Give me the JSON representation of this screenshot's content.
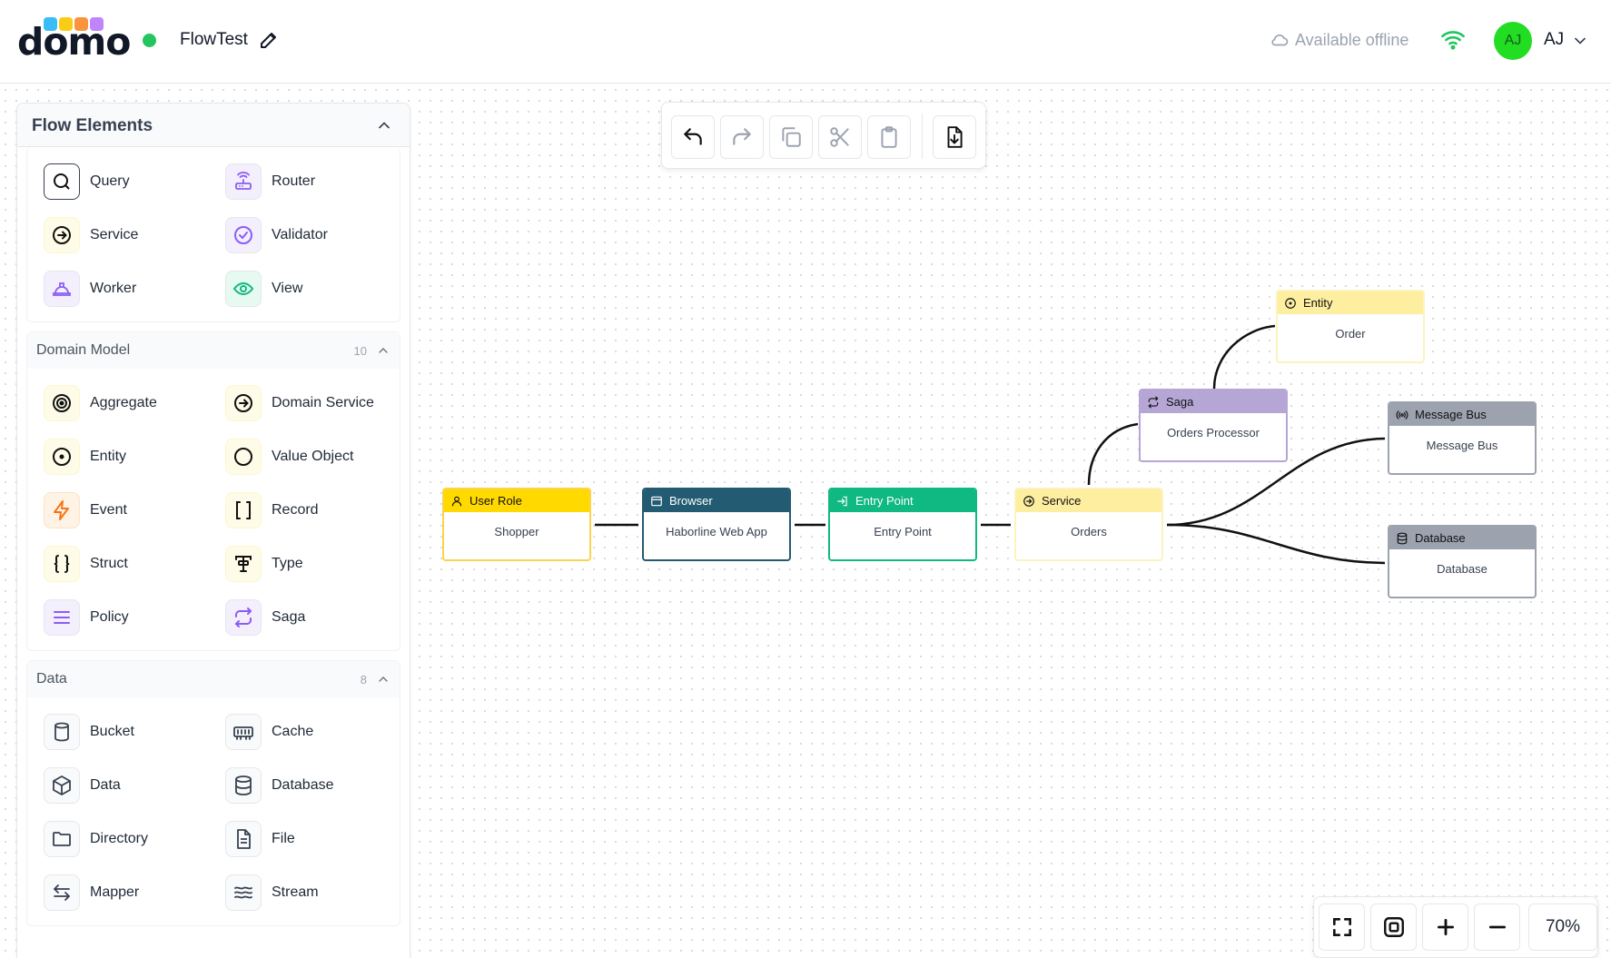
{
  "header": {
    "logo_text": "domo",
    "project_name": "FlowTest",
    "offline_label": "Available offline",
    "avatar_initials": "AJ",
    "user_initials": "AJ",
    "colors": {
      "status": "#22c55e",
      "avatar": "#22dd22",
      "logo_dots": [
        "#38bdf8",
        "#facc15",
        "#fb923c",
        "#c084fc"
      ]
    }
  },
  "sidebar": {
    "title": "Flow Elements",
    "groups": [
      {
        "title": "",
        "count": "",
        "items": [
          {
            "label": "Query",
            "icon": "search-icon"
          },
          {
            "label": "Router",
            "icon": "router-icon"
          },
          {
            "label": "Service",
            "icon": "arrow-circle-icon"
          },
          {
            "label": "Validator",
            "icon": "check-circle-icon"
          },
          {
            "label": "Worker",
            "icon": "hardhat-icon"
          },
          {
            "label": "View",
            "icon": "eye-icon"
          }
        ]
      },
      {
        "title": "Domain Model",
        "count": "10",
        "items": [
          {
            "label": "Aggregate",
            "icon": "target-icon"
          },
          {
            "label": "Domain Service",
            "icon": "arrow-circle-icon"
          },
          {
            "label": "Entity",
            "icon": "dot-circle-icon"
          },
          {
            "label": "Value Object",
            "icon": "circle-icon"
          },
          {
            "label": "Event",
            "icon": "lightning-icon"
          },
          {
            "label": "Record",
            "icon": "brackets-icon"
          },
          {
            "label": "Struct",
            "icon": "braces-icon"
          },
          {
            "label": "Type",
            "icon": "type-icon"
          },
          {
            "label": "Policy",
            "icon": "lines-icon"
          },
          {
            "label": "Saga",
            "icon": "repeat-icon"
          }
        ]
      },
      {
        "title": "Data",
        "count": "8",
        "items": [
          {
            "label": "Bucket",
            "icon": "cylinder-icon"
          },
          {
            "label": "Cache",
            "icon": "memory-icon"
          },
          {
            "label": "Data",
            "icon": "cube-icon"
          },
          {
            "label": "Database",
            "icon": "database-icon"
          },
          {
            "label": "Directory",
            "icon": "folder-icon"
          },
          {
            "label": "File",
            "icon": "file-icon"
          },
          {
            "label": "Mapper",
            "icon": "mapper-icon"
          },
          {
            "label": "Stream",
            "icon": "waves-icon"
          }
        ]
      }
    ]
  },
  "toolbar": {
    "buttons": [
      {
        "name": "undo",
        "icon": "undo-icon"
      },
      {
        "name": "redo",
        "icon": "redo-icon"
      },
      {
        "name": "copy",
        "icon": "copy-icon"
      },
      {
        "name": "cut",
        "icon": "scissors-icon"
      },
      {
        "name": "paste",
        "icon": "clipboard-icon"
      },
      {
        "name": "export",
        "icon": "file-download-icon"
      }
    ]
  },
  "nodes": {
    "user_role": {
      "type": "User Role",
      "label": "Shopper",
      "color": "#ffd900"
    },
    "browser": {
      "type": "Browser",
      "label": "Haborline Web App",
      "color": "#235c72"
    },
    "entry_point": {
      "type": "Entry Point",
      "label": "Entry Point",
      "color": "#10b981"
    },
    "service": {
      "type": "Service",
      "label": "Orders",
      "color": "#fdeea0"
    },
    "saga": {
      "type": "Saga",
      "label": "Orders Processor",
      "color": "#b5a6d6"
    },
    "entity": {
      "type": "Entity",
      "label": "Order",
      "color": "#fdeea0"
    },
    "message_bus": {
      "type": "Message Bus",
      "label": "Message Bus",
      "color": "#9ca3af"
    },
    "database": {
      "type": "Database",
      "label": "Database",
      "color": "#9ca3af"
    }
  },
  "zoom": {
    "level": "70%"
  }
}
